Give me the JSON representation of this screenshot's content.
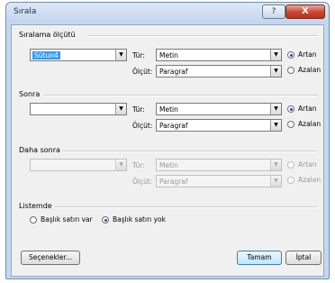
{
  "window": {
    "title": "Sırala",
    "help_label": "?",
    "close_label": "X"
  },
  "section1": {
    "heading": "Sıralama ölçütü",
    "column_value": "Sütun4",
    "tur_label": "Tür:",
    "tur_value": "Metin",
    "olcut_label": "Ölçüt:",
    "olcut_value": "Paragraf",
    "asc_label": "Artan",
    "desc_label": "Azalan"
  },
  "section2": {
    "heading": "Sonra",
    "column_value": "",
    "tur_label": "Tür:",
    "tur_value": "Metin",
    "olcut_label": "Ölçüt:",
    "olcut_value": "Paragraf",
    "asc_label": "Artan",
    "desc_label": "Azalan"
  },
  "section3": {
    "heading": "Daha sonra",
    "column_value": "",
    "tur_label": "Tür:",
    "tur_value": "Metin",
    "olcut_label": "Ölçüt:",
    "olcut_value": "Paragraf",
    "asc_label": "Artan",
    "desc_label": "Azalan"
  },
  "list": {
    "heading": "Listemde",
    "option_header": "Başlık satırı var",
    "option_no_header": "Başlık satırı yok"
  },
  "buttons": {
    "options": "Seçenekler...",
    "ok": "Tamam",
    "cancel": "İptal"
  }
}
